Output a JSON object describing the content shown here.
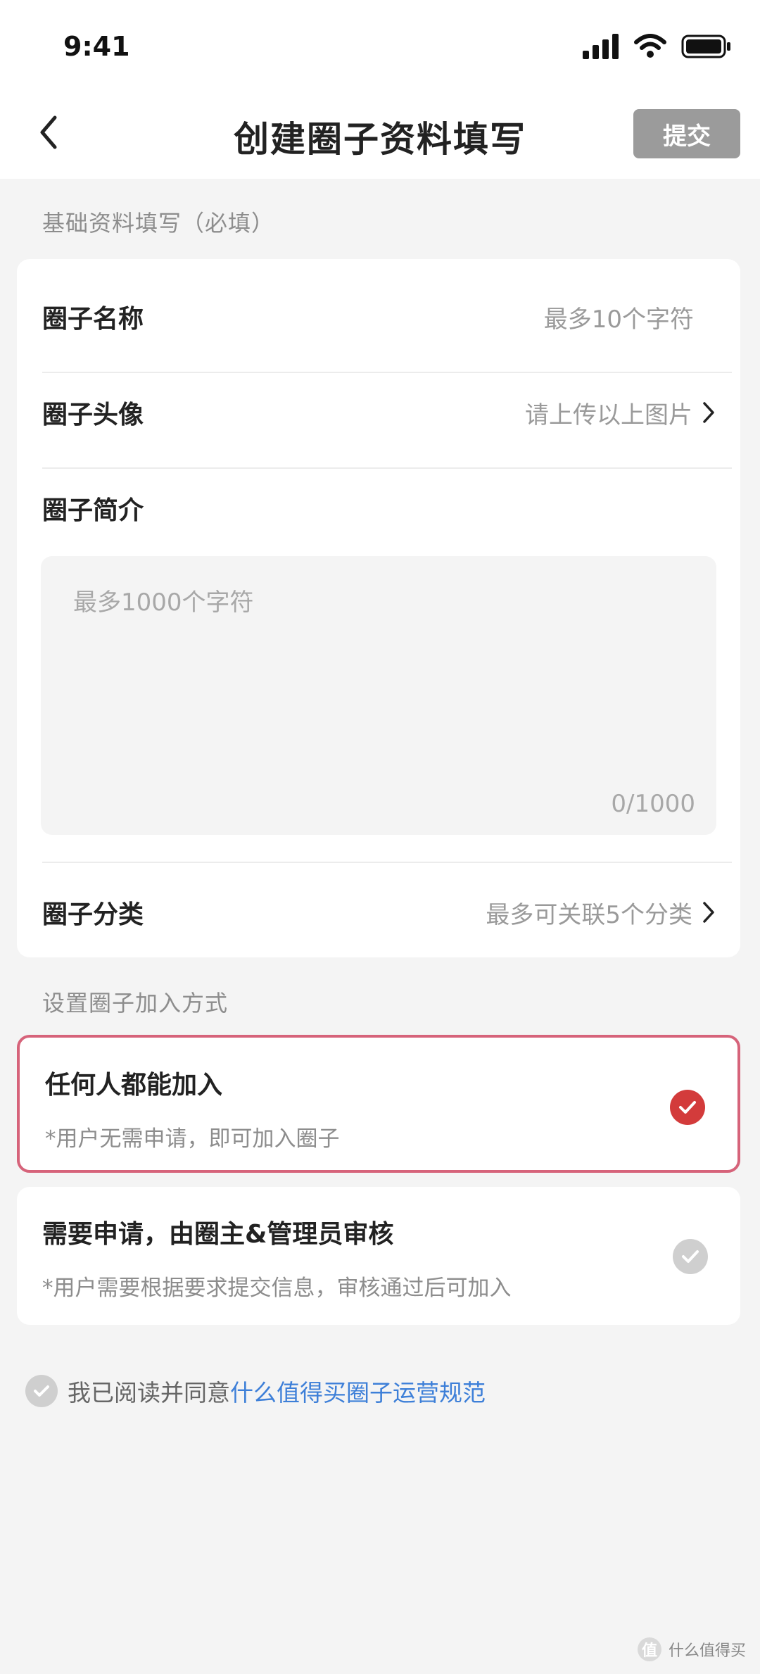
{
  "status_bar": {
    "time": "9:41"
  },
  "nav": {
    "title": "创建圈子资料填写",
    "submit_label": "提交"
  },
  "basic_section": {
    "label": "基础资料填写（必填）",
    "name_row": {
      "label": "圈子名称",
      "placeholder": "最多10个字符"
    },
    "avatar_row": {
      "label": "圈子头像",
      "hint": "请上传以上图片"
    },
    "intro_row": {
      "label": "圈子简介",
      "placeholder": "最多1000个字符",
      "counter": "0/1000"
    },
    "category_row": {
      "label": "圈子分类",
      "hint": "最多可关联5个分类"
    }
  },
  "join_section": {
    "label": "设置圈子加入方式",
    "options": [
      {
        "title": "任何人都能加入",
        "desc": "*用户无需申请，即可加入圈子",
        "selected": true
      },
      {
        "title": "需要申请，由圈主&管理员审核",
        "desc": "*用户需要根据要求提交信息，审核通过后可加入",
        "selected": false
      }
    ]
  },
  "agreement": {
    "text": "我已阅读并同意",
    "link": "什么值得买圈子运营规范",
    "checked": false
  },
  "watermark": {
    "logo_char": "值",
    "text": "什么值得买"
  },
  "colors": {
    "selected_border": "#d6637a",
    "selected_check": "#d33b3b",
    "link": "#3d7fd8",
    "submit_bg": "#9b9b9b"
  }
}
